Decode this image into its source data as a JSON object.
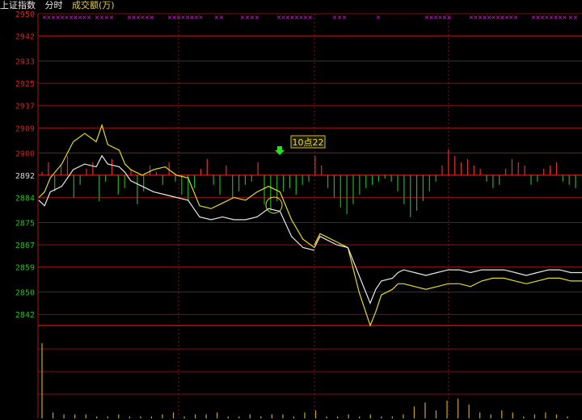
{
  "header": {
    "index_name": "上证指数",
    "mode": "分时",
    "volume_label": "成交额(万)"
  },
  "tooltip": {
    "time_label": "10点22"
  },
  "colors": {
    "background": "#000000",
    "grid": "#b01414",
    "axis_label_up": "#d02020",
    "axis_label_base": "#d8d8d8",
    "axis_label_down": "#20c020",
    "price_line": "#e8e8e8",
    "avg_line": "#e6dc1e",
    "bar_up": "#e03030",
    "bar_down": "#20b020",
    "volume_bar": "#c8a820",
    "marker": "#cc22cc",
    "arrow": "#22e022"
  },
  "chart_data": {
    "type": "line",
    "title": "",
    "ylim": [
      2838,
      2950
    ],
    "base_value": 2892,
    "yticks": [
      2950,
      2942,
      2933,
      2925,
      2917,
      2909,
      2900,
      2892,
      2884,
      2875,
      2867,
      2859,
      2850,
      2842
    ],
    "x_minutes": [
      0,
      5,
      10,
      20,
      30,
      40,
      50,
      55,
      60,
      70,
      75,
      80,
      90,
      100,
      110,
      120,
      130,
      140,
      150,
      160,
      170,
      180,
      190,
      200,
      210,
      220,
      230,
      240
    ],
    "series": [
      {
        "key": "price",
        "values": [
          2883,
          2881,
          2886,
          2888,
          2894,
          2896,
          2895,
          2899,
          2896,
          2895,
          2893,
          2890,
          2888,
          2886,
          2885,
          2884,
          2883,
          2877,
          2876,
          2877,
          2876,
          2876,
          2877,
          2880,
          2879,
          2870,
          2866,
          2865
        ]
      },
      {
        "key": "average",
        "values": [
          2884,
          2886,
          2891,
          2896,
          2904,
          2907,
          2904,
          2910,
          2903,
          2901,
          2896,
          2894,
          2892,
          2894,
          2895,
          2892,
          2891,
          2881,
          2880,
          2882,
          2884,
          2883,
          2886,
          2888,
          2886,
          2876,
          2869,
          2866
        ]
      },
      {
        "key": "price_afternoon",
        "values": [
          2866,
          2870,
          2869,
          2867,
          2866,
          2856,
          2846,
          2851,
          2854,
          2855,
          2857,
          2858,
          2857,
          2856,
          2857,
          2858,
          2858,
          2857,
          2858,
          2858,
          2858,
          2857,
          2856,
          2857,
          2858,
          2858,
          2857,
          2857
        ]
      },
      {
        "key": "average_afternoon",
        "values": [
          2867,
          2871,
          2870,
          2868,
          2866,
          2850,
          2838,
          2843,
          2849,
          2851,
          2853,
          2853,
          2852,
          2851,
          2852,
          2853,
          2853,
          2852,
          2854,
          2855,
          2855,
          2854,
          2853,
          2854,
          2855,
          2855,
          2854,
          2854
        ]
      }
    ],
    "deviation_bars": [
      1,
      4,
      -5,
      3,
      6,
      -7,
      -3,
      2,
      4,
      -8,
      -2,
      5,
      -6,
      -4,
      2,
      -9,
      -5,
      3,
      1,
      -3,
      4,
      -2,
      -6,
      -8,
      -4,
      2,
      5,
      -3,
      -6,
      3,
      -7,
      -5,
      -3,
      -2,
      4,
      -9,
      -11,
      -8,
      -5,
      -4,
      -6,
      -3,
      -2,
      6,
      3,
      -4,
      -7,
      -10,
      -12,
      -9,
      -6,
      -4,
      -3,
      -2,
      -1,
      -2,
      -5,
      -9,
      -13,
      -11,
      -8,
      -5,
      -2,
      3,
      8,
      6,
      4,
      5,
      3,
      2,
      -2,
      -4,
      -3,
      2,
      5,
      4,
      3,
      -3,
      -2,
      2,
      3,
      4,
      -2,
      -3,
      -4
    ],
    "volume_bars": [
      38,
      3,
      2,
      2,
      2,
      1,
      1,
      2,
      1,
      1,
      1,
      2,
      3,
      1,
      2,
      2,
      3,
      1,
      1,
      2,
      1,
      2,
      2,
      1,
      3,
      4,
      1,
      1,
      2,
      1,
      2,
      1,
      1,
      2,
      6,
      8,
      4,
      9,
      10,
      7,
      3,
      2,
      4,
      3,
      1,
      2,
      3,
      2,
      1
    ]
  }
}
